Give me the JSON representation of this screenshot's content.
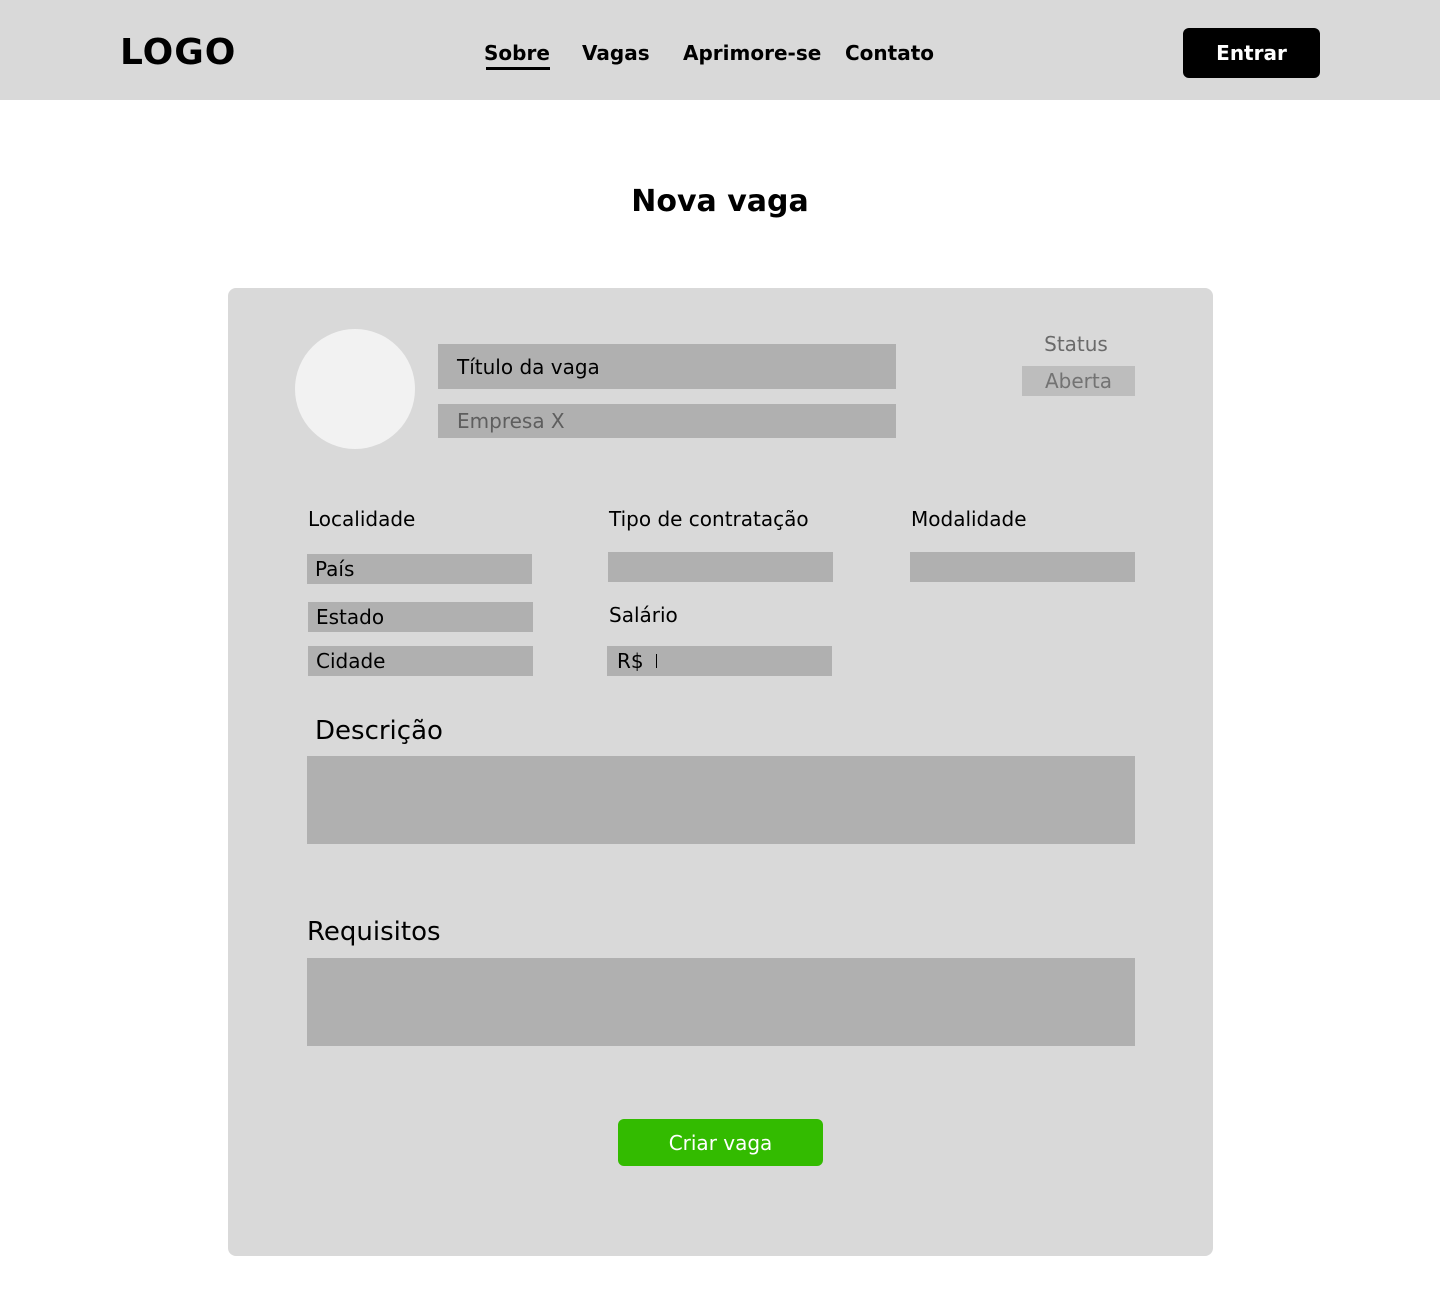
{
  "header": {
    "logo": "LOGO",
    "nav": [
      {
        "label": "Sobre",
        "active": true
      },
      {
        "label": "Vagas",
        "active": false
      },
      {
        "label": "Aprimore-se",
        "active": false
      },
      {
        "label": "Contato",
        "active": false
      }
    ],
    "login_label": "Entrar"
  },
  "page": {
    "title": "Nova vaga"
  },
  "form": {
    "job_title": "Título da vaga",
    "company": "Empresa X",
    "status": {
      "label": "Status",
      "value": "Aberta"
    },
    "location": {
      "label": "Localidade",
      "country": "País",
      "state": "Estado",
      "city": "Cidade"
    },
    "contract_type": {
      "label": "Tipo de contratação",
      "value": ""
    },
    "modality": {
      "label": "Modalidade",
      "value": ""
    },
    "salary": {
      "label": "Salário",
      "prefix": "R$"
    },
    "description": {
      "label": "Descrição",
      "value": ""
    },
    "requirements": {
      "label": "Requisitos",
      "value": ""
    },
    "submit_label": "Criar vaga"
  },
  "colors": {
    "header_bg": "#d9d9d9",
    "card_bg": "#d9d9d9",
    "field_bg": "#b0b0b0",
    "primary_button": "#33bb00",
    "login_button": "#000000"
  }
}
